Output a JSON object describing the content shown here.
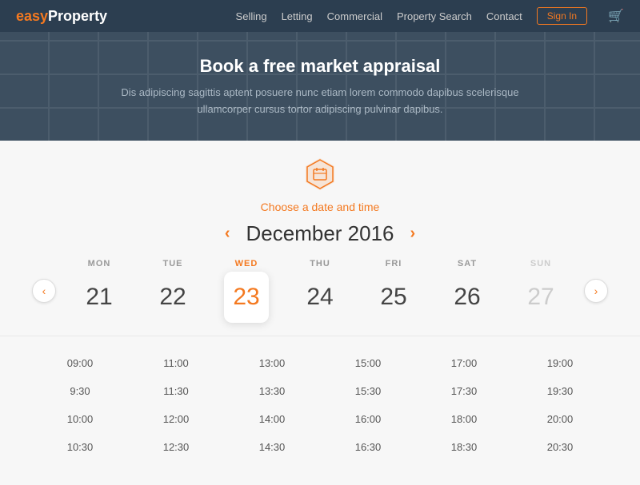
{
  "navbar": {
    "logo_prefix": "easy",
    "logo_suffix": "Property",
    "links": [
      "Selling",
      "Letting",
      "Commercial",
      "Property Search",
      "Contact"
    ],
    "signin_label": "Sign In",
    "cart_symbol": "🛒"
  },
  "hero": {
    "title": "Book a free market appraisal",
    "description": "Dis adipiscing sagittis aptent posuere nunc etiam lorem commodo dapibus scelerisque ullamcorper cursus tortor adipiscing pulvinar dapibus."
  },
  "date_section": {
    "subtitle": "Choose a date and time",
    "month_prev": "‹",
    "month_next": "›",
    "month_title": "December 2016",
    "days_prev": "›",
    "days_next": "›",
    "days": [
      {
        "name": "MON",
        "number": "21",
        "selected": false,
        "disabled": false
      },
      {
        "name": "TUE",
        "number": "22",
        "selected": false,
        "disabled": false
      },
      {
        "name": "WED",
        "number": "23",
        "selected": true,
        "disabled": false
      },
      {
        "name": "THU",
        "number": "24",
        "selected": false,
        "disabled": false
      },
      {
        "name": "FRI",
        "number": "25",
        "selected": false,
        "disabled": false
      },
      {
        "name": "SAT",
        "number": "26",
        "selected": false,
        "disabled": false
      },
      {
        "name": "SUN",
        "number": "27",
        "selected": false,
        "disabled": true
      }
    ]
  },
  "time_slots": {
    "columns": [
      [
        "09:00",
        "9:30",
        "10:00",
        "10:30"
      ],
      [
        "11:00",
        "11:30",
        "12:00",
        "12:30"
      ],
      [
        "13:00",
        "13:30",
        "14:00",
        "14:30"
      ],
      [
        "15:00",
        "15:30",
        "16:00",
        "16:30"
      ],
      [
        "17:00",
        "17:30",
        "18:00",
        "18:30"
      ],
      [
        "19:00",
        "19:30",
        "20:00",
        "20:30"
      ]
    ]
  },
  "colors": {
    "accent": "#f47920",
    "navbar_bg": "#2c3e50",
    "hero_bg": "#3d4f60"
  }
}
